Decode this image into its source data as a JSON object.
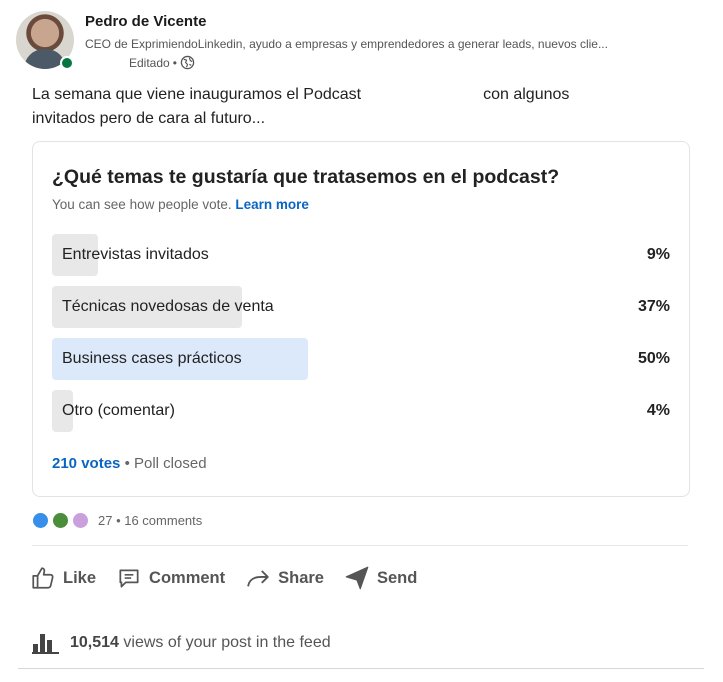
{
  "author": {
    "name": "Pedro de Vicente",
    "headline": "CEO de ExprimiendoLinkedin, ayudo a empresas y emprendedores a generar leads, nuevos clie...",
    "edited": "Editado",
    "separator": "•",
    "online_color": "#057642"
  },
  "post": {
    "text_part1": "La semana que viene inauguramos el Podcast",
    "text_part2": "con algunos",
    "text_line2": "invitados pero de cara al futuro..."
  },
  "poll": {
    "question": "¿Qué temas te gustaría que tratasemos en el podcast?",
    "subtext": "You can see how people vote.",
    "learn_more": "Learn more",
    "options": [
      {
        "label": "Entrevistas invitados",
        "percent_text": "9%",
        "percent": 9,
        "selected": false
      },
      {
        "label": "Técnicas novedosas de venta",
        "percent_text": "37%",
        "percent": 37,
        "selected": false
      },
      {
        "label": "Business cases prácticos",
        "percent_text": "50%",
        "percent": 50,
        "selected": true
      },
      {
        "label": "Otro (comentar)",
        "percent_text": "4%",
        "percent": 4,
        "selected": false
      }
    ],
    "votes": "210 votes",
    "footer_separator": "•",
    "status": "Poll closed"
  },
  "social": {
    "reaction_icons": [
      "like-icon",
      "support-icon",
      "insightful-icon"
    ],
    "counts": "27 • 16 comments"
  },
  "actions": {
    "like": "Like",
    "comment": "Comment",
    "share": "Share",
    "send": "Send"
  },
  "views": {
    "number": "10,514",
    "text": "views of your post in the feed"
  },
  "colors": {
    "link": "#0a66c2",
    "selected_fill": "#dbe9fa",
    "bar_fill": "#e8e8e8"
  }
}
